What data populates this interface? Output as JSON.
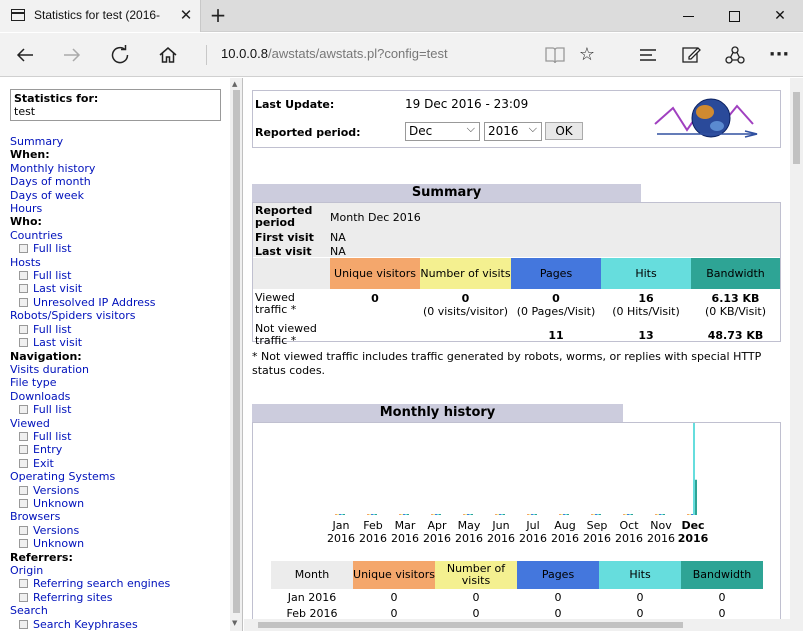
{
  "browser": {
    "tab_title": "Statistics for test (2016-",
    "tab_close": "✕",
    "new_tab": "+",
    "url_host": "10.0.0.8",
    "url_path": "/awstats/awstats.pl?config=test"
  },
  "left": {
    "stats_for_label": "Statistics for:",
    "config_name": "test",
    "menu": [
      {
        "t": "Summary",
        "k": "l"
      },
      {
        "t": "When:",
        "k": "h"
      },
      {
        "t": "Monthly history",
        "k": "l"
      },
      {
        "t": "Days of month",
        "k": "l"
      },
      {
        "t": "Days of week",
        "k": "l"
      },
      {
        "t": "Hours",
        "k": "l"
      },
      {
        "t": "Who:",
        "k": "h"
      },
      {
        "t": "Countries",
        "k": "l"
      },
      {
        "t": "Full list",
        "k": "s"
      },
      {
        "t": "Hosts",
        "k": "l"
      },
      {
        "t": "Full list",
        "k": "s"
      },
      {
        "t": "Last visit",
        "k": "s"
      },
      {
        "t": "Unresolved IP Address",
        "k": "s"
      },
      {
        "t": "Robots/Spiders visitors",
        "k": "l"
      },
      {
        "t": "Full list",
        "k": "s"
      },
      {
        "t": "Last visit",
        "k": "s"
      },
      {
        "t": "Navigation:",
        "k": "h"
      },
      {
        "t": "Visits duration",
        "k": "l"
      },
      {
        "t": "File type",
        "k": "l"
      },
      {
        "t": "Downloads",
        "k": "l"
      },
      {
        "t": "Full list",
        "k": "s"
      },
      {
        "t": "Viewed",
        "k": "l"
      },
      {
        "t": "Full list",
        "k": "s"
      },
      {
        "t": "Entry",
        "k": "s"
      },
      {
        "t": "Exit",
        "k": "s"
      },
      {
        "t": "Operating Systems",
        "k": "l"
      },
      {
        "t": "Versions",
        "k": "s"
      },
      {
        "t": "Unknown",
        "k": "s"
      },
      {
        "t": "Browsers",
        "k": "l"
      },
      {
        "t": "Versions",
        "k": "s"
      },
      {
        "t": "Unknown",
        "k": "s"
      },
      {
        "t": "Referrers:",
        "k": "h"
      },
      {
        "t": "Origin",
        "k": "l"
      },
      {
        "t": "Referring search engines",
        "k": "s"
      },
      {
        "t": "Referring sites",
        "k": "s"
      },
      {
        "t": "Search",
        "k": "l"
      },
      {
        "t": "Search Keyphrases",
        "k": "s"
      }
    ]
  },
  "header": {
    "last_update_label": "Last Update:",
    "last_update_value": "19 Dec 2016 - 23:09",
    "reported_period_label": "Reported period:",
    "month_select": "Dec",
    "year_select": "2016",
    "ok_label": "OK"
  },
  "summary": {
    "title": "Summary",
    "reported_period_label": "Reported period",
    "reported_period_value": "Month Dec 2016",
    "first_visit_label": "First visit",
    "first_visit_value": "NA",
    "last_visit_label": "Last visit",
    "last_visit_value": "NA",
    "columns": [
      "Unique visitors",
      "Number of visits",
      "Pages",
      "Hits",
      "Bandwidth"
    ],
    "viewed_label": "Viewed traffic *",
    "viewed": [
      "0",
      "0",
      "0",
      "16",
      "6.13 KB"
    ],
    "viewed_sub": [
      "",
      "(0 visits/visitor)",
      "(0 Pages/Visit)",
      "(0 Hits/Visit)",
      "(0 KB/Visit)"
    ],
    "not_viewed_label": "Not viewed traffic *",
    "not_viewed": [
      "",
      "",
      "11",
      "13",
      "48.73 KB"
    ],
    "footnote": "* Not viewed traffic includes traffic generated by robots, worms, or replies with special HTTP status codes."
  },
  "history": {
    "title": "Monthly history",
    "table_columns": [
      "Month",
      "Unique visitors",
      "Number of visits",
      "Pages",
      "Hits",
      "Bandwidth"
    ],
    "rows": [
      [
        "Jan 2016",
        "0",
        "0",
        "0",
        "0",
        "0"
      ],
      [
        "Feb 2016",
        "0",
        "0",
        "0",
        "0",
        "0"
      ]
    ]
  },
  "chart_data": {
    "type": "bar",
    "categories": [
      "Jan 2016",
      "Feb 2016",
      "Mar 2016",
      "Apr 2016",
      "May 2016",
      "Jun 2016",
      "Jul 2016",
      "Aug 2016",
      "Sep 2016",
      "Oct 2016",
      "Nov 2016",
      "Dec 2016"
    ],
    "month_labels": [
      "Jan",
      "Feb",
      "Mar",
      "Apr",
      "May",
      "Jun",
      "Jul",
      "Aug",
      "Sep",
      "Oct",
      "Nov",
      "Dec"
    ],
    "year_label": "2016",
    "highlight": "Dec",
    "series": [
      {
        "values": [
          0,
          0,
          0,
          0,
          0,
          0,
          0,
          0,
          0,
          0,
          0,
          0
        ],
        "color": "#f4a76c"
      },
      {
        "values": [
          0,
          0,
          0,
          0,
          0,
          0,
          0,
          0,
          0,
          0,
          0,
          0
        ],
        "color": "#f4f090"
      },
      {
        "values": [
          0,
          0,
          0,
          0,
          0,
          0,
          0,
          0,
          0,
          0,
          0,
          0
        ],
        "color": "#4477dd"
      },
      {
        "values": [
          0,
          0,
          0,
          0,
          0,
          0,
          0,
          0,
          0,
          0,
          0,
          16
        ],
        "color": "#66dddd"
      },
      {
        "values": [
          0,
          0,
          0,
          0,
          0,
          0,
          0,
          0,
          0,
          0,
          0,
          6.13
        ],
        "color": "#2ea495"
      }
    ]
  },
  "colors": {
    "unique_visitors": "#f4a76c",
    "visits": "#f4f090",
    "pages": "#4477dd",
    "hits": "#66dddd",
    "bandwidth": "#2ea495",
    "link": "#0011bb",
    "section_title": "#ccccdd"
  }
}
